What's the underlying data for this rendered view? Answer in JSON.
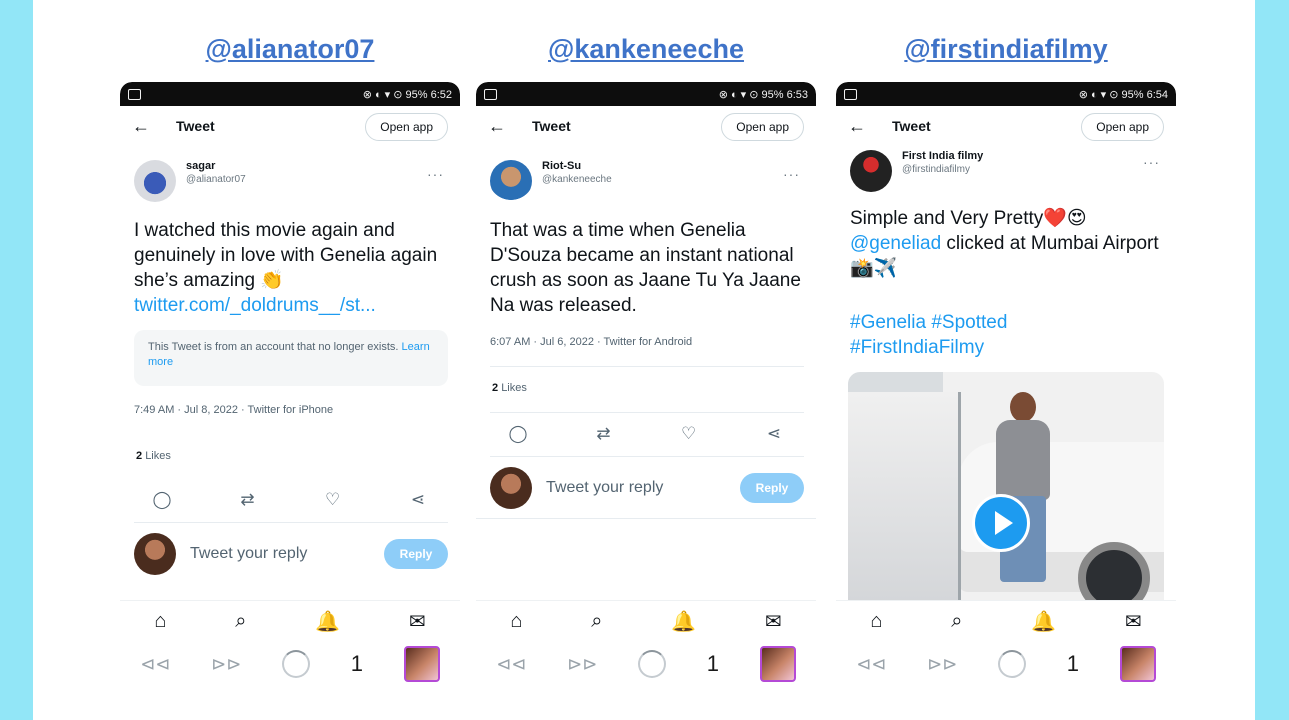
{
  "colors": {
    "background": "#92e6f7",
    "handle": "#3f73c8",
    "link": "#1d9bf0",
    "reply_button": "#8ecdf8"
  },
  "panels": [
    {
      "handle": "@alianator07",
      "status_right": "⊗ ◐ ▾ ⊙ 95% 6:52",
      "topbar_title": "Tweet",
      "open_app": "Open app",
      "author_name": "sagar",
      "author_handle": "@alianator07",
      "more": "···",
      "text": "I watched this movie again and genuinely in love with Genelia again she’s amazing 👏",
      "link_text": "twitter.com/_doldrums__/st...",
      "notice": "This Tweet is from an account that no longer exists.",
      "notice_link": "Learn more",
      "meta": "7:49 AM · Jul 8, 2022 · Twitter for iPhone",
      "likes_count": "2",
      "likes_label": "Likes",
      "reply_placeholder": "Tweet your reply",
      "reply_button": "Reply",
      "sys_count": "1"
    },
    {
      "handle": "@kankeneeche",
      "status_right": "⊗ ◐ ▾ ⊙ 95% 6:53",
      "topbar_title": "Tweet",
      "open_app": "Open app",
      "author_name": "Riot-Su",
      "author_handle": "@kankeneeche",
      "more": "···",
      "text": "That was a time when Genelia D'Souza became an instant national crush as soon as Jaane Tu Ya Jaane Na was released.",
      "meta": "6:07 AM · Jul 6, 2022 · Twitter for Android",
      "likes_count": "2",
      "likes_label": "Likes",
      "reply_placeholder": "Tweet your reply",
      "reply_button": "Reply",
      "sys_count": "1"
    },
    {
      "handle": "@firstindiafilmy",
      "status_right": "⊗ ◐ ▾ ⊙ 95% 6:54",
      "topbar_title": "Tweet",
      "open_app": "Open app",
      "author_name": "First India filmy",
      "author_handle": "@firstindiafilmy",
      "more": "···",
      "text_plain": "Simple and Very Pretty❤️😍",
      "mention": "@geneliad",
      "text_after": " clicked at Mumbai Airport 📸✈️",
      "hashtags_line1": "#Genelia #Spotted",
      "hashtags_line2": "#FirstIndiaFilmy",
      "sys_count": "1"
    }
  ],
  "icons": {
    "back": "←",
    "reply": "◯",
    "retweet": "⇄",
    "like": "♡",
    "share": "⋖",
    "home": "⌂",
    "search": "⌕",
    "bell": "🔔",
    "mail": "✉",
    "sys_back": "⊲⊲",
    "sys_forward": "⊳⊳"
  }
}
